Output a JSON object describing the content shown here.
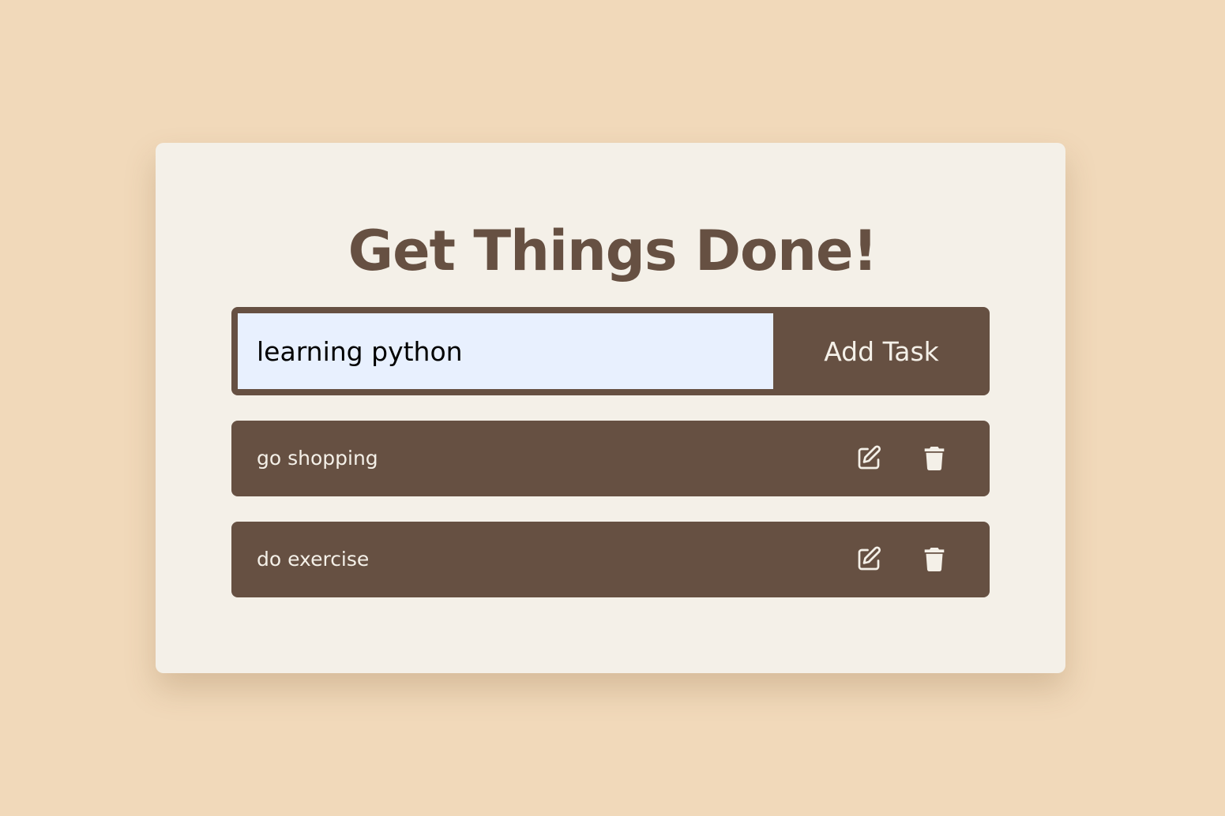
{
  "app": {
    "title": "Get Things Done!"
  },
  "form": {
    "input_value": "learning python",
    "add_button_label": "Add Task"
  },
  "tasks": [
    {
      "label": "go shopping"
    },
    {
      "label": "do exercise"
    }
  ],
  "colors": {
    "background": "#F1D9BA",
    "card": "#F4F0E8",
    "accent": "#665042",
    "input_background": "#E8F0FE",
    "text_light": "#F4F0E8"
  },
  "icons": {
    "edit": "edit-icon",
    "delete": "trash-icon"
  }
}
